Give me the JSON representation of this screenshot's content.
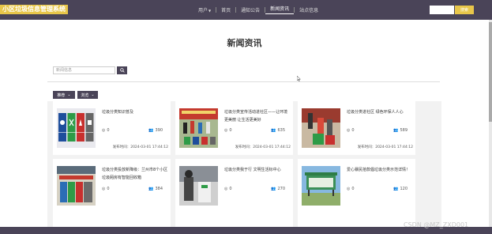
{
  "header": {
    "logo": "小区垃圾信息管理系统",
    "nav": [
      {
        "label": "用户"
      },
      {
        "label": "首页"
      },
      {
        "label": "通知公告"
      },
      {
        "label": "新闻资讯"
      },
      {
        "label": "站点信息"
      }
    ],
    "search_btn": "搜索"
  },
  "page": {
    "title": "新闻资讯",
    "search_placeholder": "新闻信息",
    "filters": [
      "推荐",
      "浏览"
    ]
  },
  "news": [
    {
      "title": "垃圾分类知识普及",
      "views": "0",
      "likes": "390",
      "time": "发布时间：2024-03-01 17:44:12"
    },
    {
      "title": "垃圾分类宣传活动进社区——让环境更美丽 让生活更美好",
      "views": "0",
      "likes": "635",
      "time": "发布时间：2024-03-01 17:44:12"
    },
    {
      "title": "垃圾分类进社区 绿色环保人人心",
      "views": "0",
      "likes": "589",
      "time": "发布时间：2024-03-01 17:44:12"
    },
    {
      "title": "垃圾分类投放新降级：兰州市8个小区垃圾厢房有智能回收箱",
      "views": "0",
      "likes": "384",
      "time": ""
    },
    {
      "title": "垃圾分类我于行 文明生活标中心",
      "views": "0",
      "likes": "270",
      "time": ""
    },
    {
      "title": "爱心暴民拾款倡垃圾分类示范详情！",
      "views": "0",
      "likes": "120",
      "time": ""
    }
  ],
  "watermark": "CSDN @MZ_ZXD001",
  "colors": {
    "header": "#4a4458",
    "accent": "#e8c64a"
  }
}
